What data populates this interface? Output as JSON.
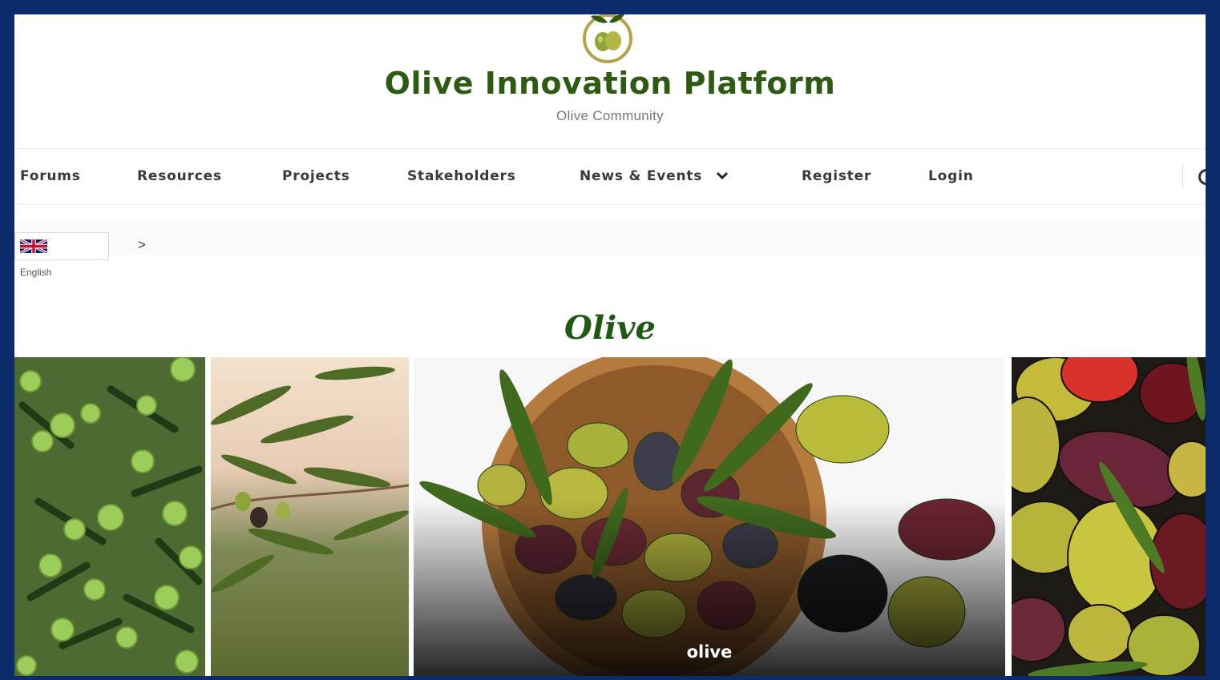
{
  "header": {
    "title": "Olive Innovation Platform",
    "subtitle": "Olive Community",
    "logo_icon": "olive-branch-logo-icon"
  },
  "nav": {
    "items": [
      {
        "label": "Forums"
      },
      {
        "label": "Resources"
      },
      {
        "label": "Projects"
      },
      {
        "label": "Stakeholders"
      },
      {
        "label": "News & Events",
        "icon": "chevron-down-icon"
      },
      {
        "label": "Register"
      },
      {
        "label": "Login"
      }
    ],
    "search_icon": "search-icon"
  },
  "language": {
    "flag_icon": "uk-flag-icon",
    "label": "English"
  },
  "breadcrumb": {
    "separator": ">"
  },
  "section": {
    "title": "Olive"
  },
  "gallery": {
    "tiles": [
      {
        "image": "green olives on tree",
        "caption": ""
      },
      {
        "image": "olive branch against sunset",
        "caption": ""
      },
      {
        "image": "bowl of olives with leaves",
        "caption": "olive"
      },
      {
        "image": "mixed olives close-up",
        "caption": ""
      }
    ]
  },
  "colors": {
    "frame_border": "#0d2a6b",
    "brand_green": "#2e5b12",
    "heading_green": "#1e5a14",
    "nav_text": "#3a3a3a"
  }
}
